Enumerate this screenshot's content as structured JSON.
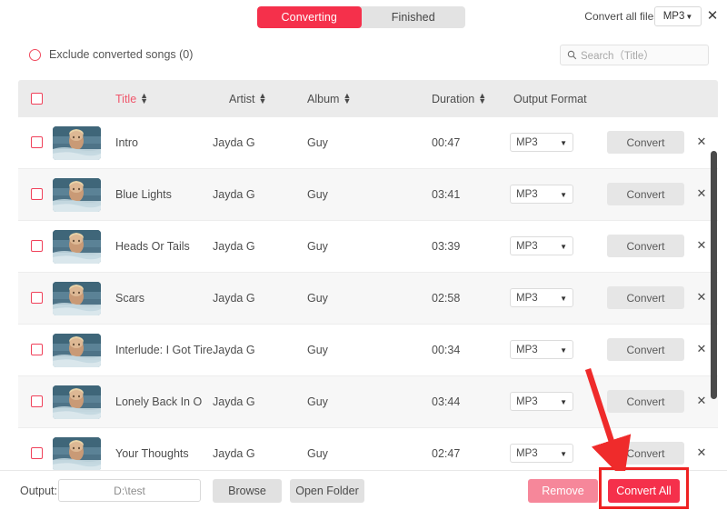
{
  "window": {
    "close_icon": "close-icon",
    "convert_all_to_label": "Convert all files to:",
    "global_format": "MP3"
  },
  "tabs": [
    {
      "label": "Converting",
      "active": true
    },
    {
      "label": "Finished",
      "active": false
    }
  ],
  "toolbar": {
    "exclude_label": "Exclude converted songs (0)",
    "exclude_icon": "radio-circle-icon",
    "search_icon": "search-icon",
    "search_placeholder": "Search（Title）",
    "search_value": ""
  },
  "table": {
    "columns": [
      {
        "key": "title",
        "label": "Title",
        "sortable": true,
        "sorted": true
      },
      {
        "key": "artist",
        "label": "Artist",
        "sortable": true,
        "sorted": false
      },
      {
        "key": "album",
        "label": "Album",
        "sortable": true,
        "sorted": false
      },
      {
        "key": "duration",
        "label": "Duration",
        "sortable": true,
        "sorted": false
      },
      {
        "key": "output_format",
        "label": "Output Format",
        "sortable": false,
        "sorted": false
      }
    ],
    "header_checkbox_checked": false,
    "row_action_label": "Convert",
    "row_remove_icon": "close-icon",
    "rows": [
      {
        "checked": false,
        "thumb": "album-art-woman-in-water",
        "title": "Intro",
        "artist": "Jayda G",
        "album": "Guy",
        "duration": "00:47",
        "format": "MP3"
      },
      {
        "checked": false,
        "thumb": "album-art-woman-in-water",
        "title": "Blue Lights",
        "artist": "Jayda G",
        "album": "Guy",
        "duration": "03:41",
        "format": "MP3"
      },
      {
        "checked": false,
        "thumb": "album-art-woman-in-water",
        "title": "Heads Or Tails",
        "artist": "Jayda G",
        "album": "Guy",
        "duration": "03:39",
        "format": "MP3"
      },
      {
        "checked": false,
        "thumb": "album-art-woman-in-water",
        "title": "Scars",
        "artist": "Jayda G",
        "album": "Guy",
        "duration": "02:58",
        "format": "MP3"
      },
      {
        "checked": false,
        "thumb": "album-art-woman-in-water",
        "title": "Interlude: I Got Tire…",
        "artist": "Jayda G",
        "album": "Guy",
        "duration": "00:34",
        "format": "MP3"
      },
      {
        "checked": false,
        "thumb": "album-art-woman-in-water",
        "title": "Lonely Back In O",
        "artist": "Jayda G",
        "album": "Guy",
        "duration": "03:44",
        "format": "MP3"
      },
      {
        "checked": false,
        "thumb": "album-art-woman-in-water",
        "title": "Your Thoughts",
        "artist": "Jayda G",
        "album": "Guy",
        "duration": "02:47",
        "format": "MP3"
      }
    ]
  },
  "footer": {
    "output_label": "Output:",
    "output_path": "D:\\test",
    "browse_label": "Browse",
    "open_folder_label": "Open Folder",
    "remove_label": "Remove",
    "convert_all_label": "Convert All"
  },
  "annotations": {
    "arrow_icon": "red-arrow-icon",
    "highlight_target": "convert-all-button"
  },
  "colors": {
    "accent_red": "#f5304b",
    "accent_red_soft": "#f6879a",
    "sorted_header": "#f0566b",
    "checkbox_border": "#f0415a",
    "annotation_red": "#ee2222",
    "header_bg": "#ebebeb",
    "row_alt_bg": "#f7f7f7",
    "button_gray": "#e1e1e1"
  }
}
